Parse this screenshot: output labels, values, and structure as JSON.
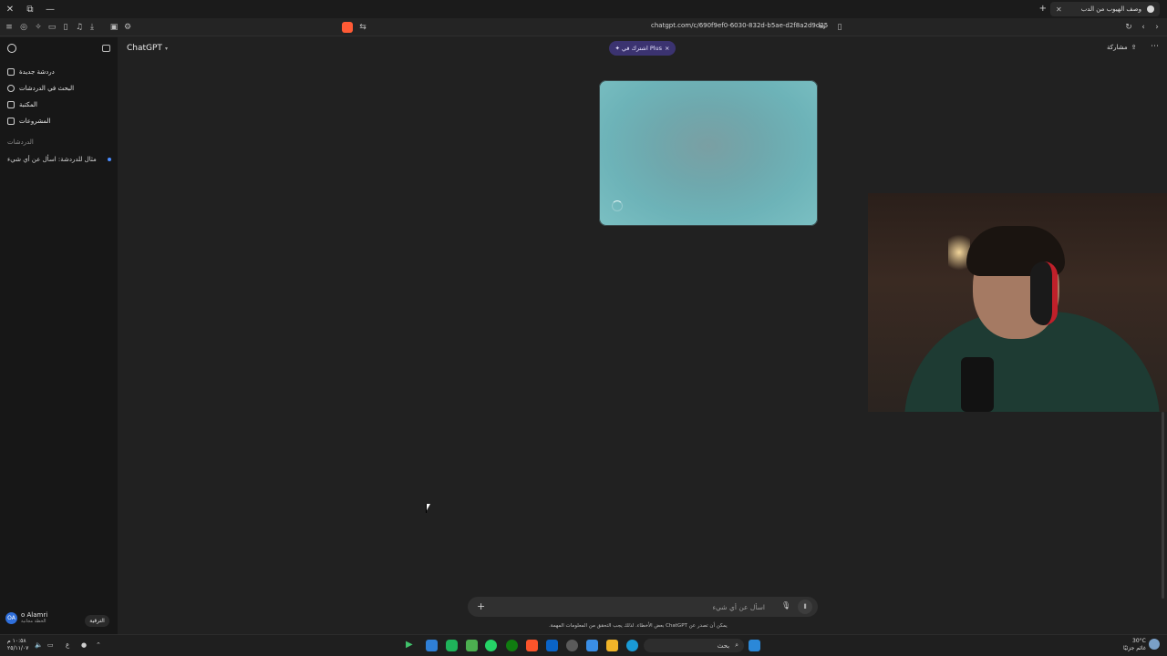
{
  "browser": {
    "tab_title": "وصف الهيوب من الدب",
    "url": "chatgpt.com/c/690f9ef0-6030-832d-b5ae-d2f8a2d9d25"
  },
  "sidebar": {
    "items": [
      {
        "label": "دردشة جديدة",
        "icon": "new-chat-icon"
      },
      {
        "label": "البحث في الدردشات",
        "icon": "search-icon"
      },
      {
        "label": "المكتبة",
        "icon": "library-icon"
      },
      {
        "label": "المشروعات",
        "icon": "folder-icon"
      }
    ],
    "section_title": "الدردشات",
    "chats": [
      {
        "title": "مثال للدردشة: اسأل عن أي شيء"
      }
    ],
    "user": {
      "initials": "OA",
      "name": "o Alamri",
      "plan": "الخطة مجانية",
      "upgrade_label": "الترقية"
    }
  },
  "header": {
    "model": "ChatGPT",
    "plus_label": "✦ اشترك في Plus",
    "plus_close": "×",
    "share_label": "مشاركة"
  },
  "composer": {
    "placeholder": "اسأل عن أي شيء",
    "disclaimer": ".بعض الأخطاء. لذلك يجب التحقق من المعلومات المهمة ChatGPT يمكن أن تصدر عن"
  },
  "taskbar": {
    "search_label": "بحث",
    "time": "١٠:٥٨ م",
    "date": "٢٥/١١/٠٧",
    "temperature": "30°C",
    "weather": "غائم جزئيًا",
    "lang": "ع"
  },
  "colors": {
    "background": "#212121",
    "sidebar": "#171717",
    "accent_plus": "#3b3370",
    "image_card": "#6db3b8"
  }
}
